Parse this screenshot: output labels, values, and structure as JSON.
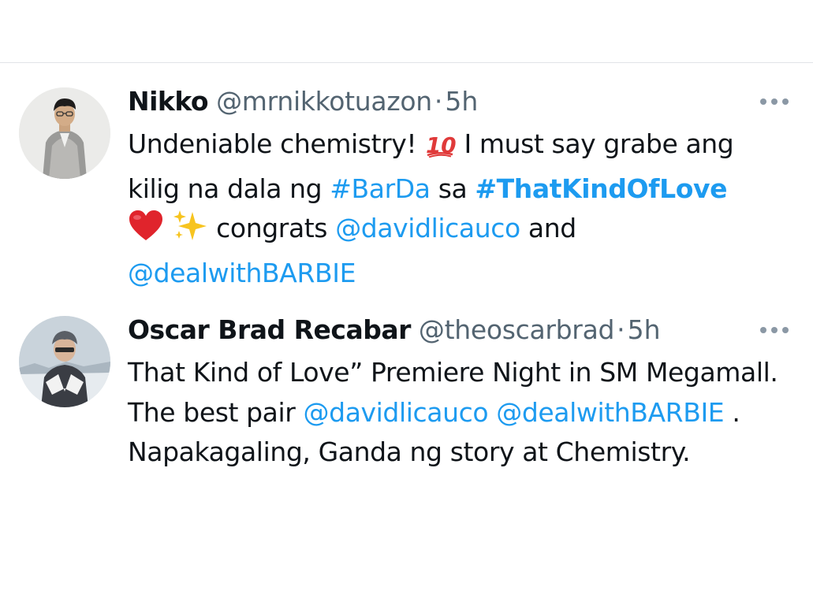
{
  "tweets": [
    {
      "name": "Nikko",
      "handle": "@mrnikkotuazon",
      "dot": "·",
      "time": "5h",
      "body": {
        "t1": "Undeniable chemistry! ",
        "e1": "💯",
        "t2": " I must say grabe ang kilig na dala ng ",
        "h1": "#BarDa",
        "t3": " sa ",
        "h2": "#ThatKindOfLove",
        "t4": " ",
        "e2": "❤️",
        "e3": "✨",
        "t5": " congrats ",
        "m1": "@davidlicauco",
        "t6": " and ",
        "m2": "@dealwithBARBIE"
      }
    },
    {
      "name": "Oscar Brad Recabar",
      "handle": "@theoscarbrad",
      "dot": "·",
      "time": "5h",
      "body": {
        "t1": "That Kind of Love” Premiere Night in SM Megamall. The best pair ",
        "m1": "@davidlicauco",
        "t2": " ",
        "m2": "@dealwithBARBIE",
        "t3": " . Napakagaling, Ganda ng story at Chemistry."
      }
    }
  ],
  "icons": {
    "more": "more-horizontal-icon"
  },
  "colors": {
    "link": "#1d9bf0",
    "secondary": "#536471",
    "text": "#0f1419",
    "divider": "#e1e4e7"
  }
}
